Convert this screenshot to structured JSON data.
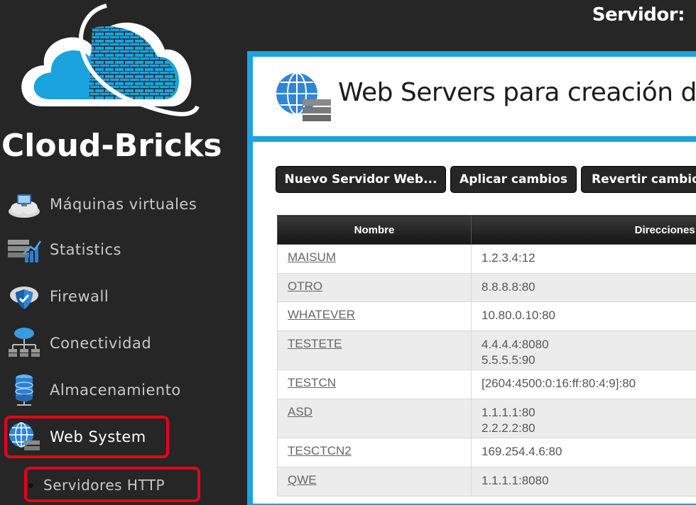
{
  "header": {
    "server_label": "Servidor:"
  },
  "brand": {
    "name": "Cloud-Bricks"
  },
  "sidebar": {
    "items": [
      {
        "label": "Máquinas virtuales",
        "icon": "virtual-machines-icon"
      },
      {
        "label": "Statistics",
        "icon": "statistics-icon"
      },
      {
        "label": "Firewall",
        "icon": "firewall-shield-icon"
      },
      {
        "label": "Conectividad",
        "icon": "network-icon"
      },
      {
        "label": "Almacenamiento",
        "icon": "storage-icon"
      },
      {
        "label": "Web System",
        "icon": "web-system-icon",
        "active": true
      }
    ],
    "subitems": [
      {
        "label": "Servidores HTTP"
      }
    ]
  },
  "page": {
    "title": "Web Servers para creación de"
  },
  "toolbar": {
    "new_label": "Nuevo Servidor Web...",
    "apply_label": "Aplicar cambios",
    "revert_label": "Revertir cambio"
  },
  "table": {
    "headers": [
      "Nombre",
      "Direcciones I"
    ],
    "rows": [
      {
        "name": "MAISUM",
        "addresses": [
          "1.2.3.4:12"
        ]
      },
      {
        "name": "OTRO",
        "addresses": [
          "8.8.8.8:80"
        ]
      },
      {
        "name": "WHATEVER",
        "addresses": [
          "10.80.0.10:80"
        ]
      },
      {
        "name": "TESTETE",
        "addresses": [
          "4.4.4.4:8080",
          "5.5.5.5:90"
        ]
      },
      {
        "name": "TESTCN",
        "addresses": [
          "[2604:4500:0:16:ff:80:4:9]:80"
        ]
      },
      {
        "name": "ASD",
        "addresses": [
          "1.1.1.1:80",
          "2.2.2.2:80"
        ]
      },
      {
        "name": "TESCTCN2",
        "addresses": [
          "169.254.4.6:80"
        ]
      },
      {
        "name": "QWE",
        "addresses": [
          "1.1.1.1:8080"
        ]
      }
    ]
  },
  "colors": {
    "accent": "#1ba3df",
    "highlight": "#e8001c",
    "sidebar_bg": "#262626"
  }
}
